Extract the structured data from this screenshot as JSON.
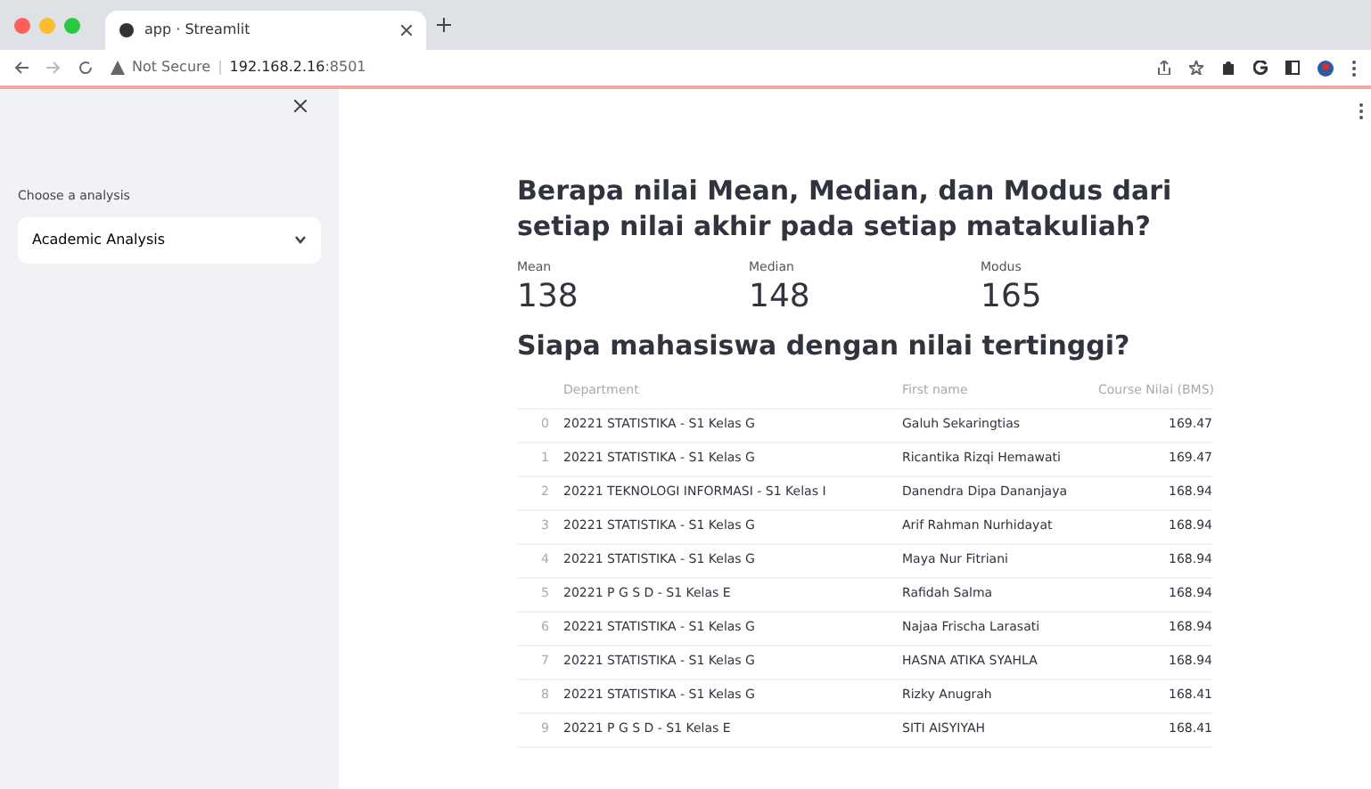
{
  "browser": {
    "tab_title": "app · Streamlit",
    "url_prefix": "Not Secure",
    "url_separator": "|",
    "url_host": "192.168.2.16",
    "url_port": ":8501"
  },
  "sidebar": {
    "select_label": "Choose a analysis",
    "select_value": "Academic Analysis"
  },
  "main": {
    "heading_1": "Berapa nilai Mean, Median, dan Modus dari setiap nilai akhir pada setiap matakuliah?",
    "metrics": [
      {
        "label": "Mean",
        "value": "138"
      },
      {
        "label": "Median",
        "value": "148"
      },
      {
        "label": "Modus",
        "value": "165"
      }
    ],
    "heading_2": "Siapa mahasiswa dengan nilai tertinggi?",
    "table": {
      "columns": [
        "",
        "Department",
        "First name",
        "Course Nilai (BMS)"
      ],
      "rows": [
        [
          "0",
          "20221 STATISTIKA - S1 Kelas G",
          "Galuh Sekaringtias",
          "169.47"
        ],
        [
          "1",
          "20221 STATISTIKA - S1 Kelas G",
          "Ricantika Rizqi Hemawati",
          "169.47"
        ],
        [
          "2",
          "20221 TEKNOLOGI INFORMASI - S1 Kelas I",
          "Danendra Dipa Dananjaya",
          "168.94"
        ],
        [
          "3",
          "20221 STATISTIKA - S1 Kelas G",
          "Arif Rahman Nurhidayat",
          "168.94"
        ],
        [
          "4",
          "20221 STATISTIKA - S1 Kelas G",
          "Maya Nur Fitriani",
          "168.94"
        ],
        [
          "5",
          "20221 P G S D - S1 Kelas E",
          "Rafidah Salma",
          "168.94"
        ],
        [
          "6",
          "20221 STATISTIKA - S1 Kelas G",
          "Najaa Frischa Larasati",
          "168.94"
        ],
        [
          "7",
          "20221 STATISTIKA - S1 Kelas G",
          "HASNA ATIKA SYAHLA",
          "168.94"
        ],
        [
          "8",
          "20221 STATISTIKA - S1 Kelas G",
          "Rizky Anugrah",
          "168.41"
        ],
        [
          "9",
          "20221 P G S D - S1 Kelas E",
          "SITI AISYIYAH",
          "168.41"
        ]
      ]
    }
  }
}
